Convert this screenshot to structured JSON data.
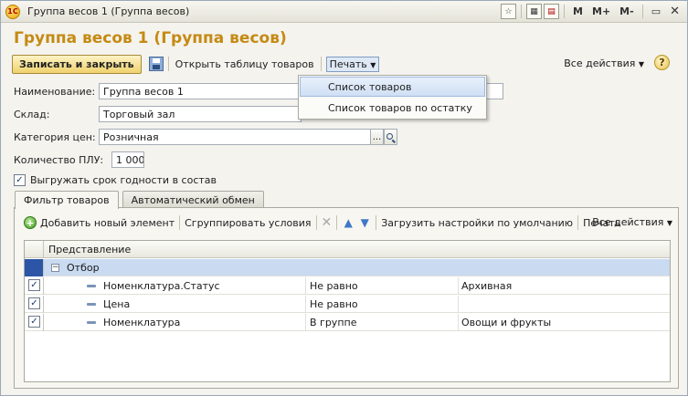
{
  "window": {
    "title": "Группа весов 1 (Группа весов)",
    "logo_text": "1С",
    "tools": [
      "M",
      "M+",
      "M-"
    ]
  },
  "form": {
    "title": "Группа весов 1 (Группа весов)"
  },
  "command_bar": {
    "save_close": "Записать и закрыть",
    "open_table": "Открыть таблицу товаров",
    "print": "Печать",
    "all_actions": "Все действия",
    "help": "?"
  },
  "print_menu": {
    "items": [
      "Список товаров",
      "Список товаров по остатку"
    ]
  },
  "fields": {
    "name_label": "Наименование:",
    "name_value": "Группа весов 1",
    "warehouse_label": "Склад:",
    "warehouse_value": "Торговый зал",
    "price_category_label": "Категория цен:",
    "price_category_value": "Розничная",
    "plu_count_label": "Количество ПЛУ:",
    "plu_count_value": "1 000",
    "export_shelf_life_label": "Выгружать срок годности в состав",
    "export_shelf_life_checked": true,
    "pick_button": "..."
  },
  "tabs": [
    "Фильтр товаров",
    "Автоматический обмен"
  ],
  "filter_toolbar": {
    "add_new": "Добавить новый элемент",
    "group_conditions": "Сгруппировать условия",
    "load_defaults": "Загрузить настройки по умолчанию",
    "print": "Печать",
    "all_actions": "Все действия"
  },
  "grid": {
    "header": "Представление",
    "group_row": "Отбор",
    "rows": [
      {
        "field": "Номенклатура.Статус",
        "condition": "Не равно",
        "value": "Архивная",
        "checked": true
      },
      {
        "field": "Цена",
        "condition": "Не равно",
        "value": "",
        "checked": true
      },
      {
        "field": "Номенклатура",
        "condition": "В группе",
        "value": "Овощи и фрукты",
        "checked": true
      }
    ]
  }
}
